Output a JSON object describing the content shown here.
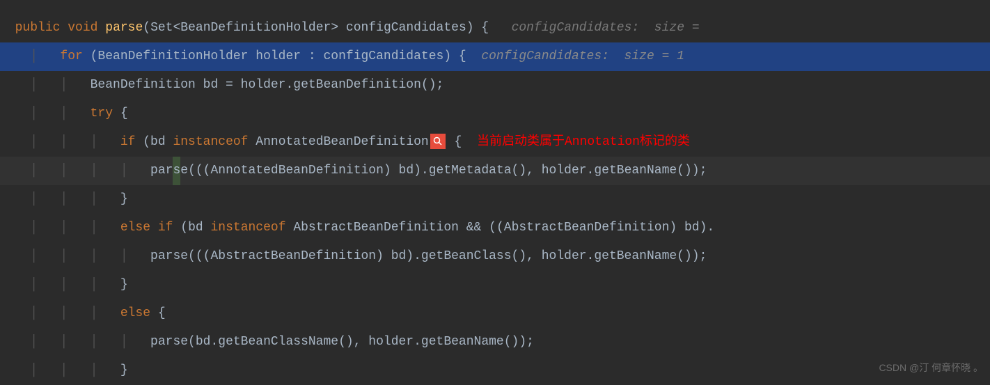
{
  "code": {
    "l1": {
      "kw1": "public",
      "kw2": "void",
      "method": "parse",
      "sig": "(Set<BeanDefinitionHolder> configCandidates) {",
      "hint": "configCandidates:  size ="
    },
    "l2": {
      "kw": "for",
      "body": " (BeanDefinitionHolder holder : configCandidates) {  ",
      "hint": "configCandidates:  size = 1"
    },
    "l3": {
      "text": "BeanDefinition bd = holder.getBeanDefinition();"
    },
    "l4": {
      "kw": "try",
      "text": " {"
    },
    "l5": {
      "kw": "if",
      "pre": " (bd ",
      "kw2": "instanceof",
      "mid": " AnnotatedBeanDefinition",
      "post": " {  ",
      "annot": "当前启动类属于Annotation标记的类"
    },
    "l6": {
      "pre": "par",
      "cursor": "s",
      "post": "e(((AnnotatedBeanDefinition) bd).getMetadata(), holder.getBeanName());"
    },
    "l7": {
      "text": "}"
    },
    "l8": {
      "kw1": "else",
      "kw2": "if",
      "pre": " (bd ",
      "kw3": "instanceof",
      "post": " AbstractBeanDefinition && ((AbstractBeanDefinition) bd)."
    },
    "l9": {
      "text": "parse(((AbstractBeanDefinition) bd).getBeanClass(), holder.getBeanName());"
    },
    "l10": {
      "text": "}"
    },
    "l11": {
      "kw": "else",
      "text": " {"
    },
    "l12": {
      "text": "parse(bd.getBeanClassName(), holder.getBeanName());"
    },
    "l13": {
      "text": "}"
    }
  },
  "indent": {
    "s2": "  ",
    "guide1": "    │   ",
    "guide2": "    │   │   ",
    "guide3": "    │   │   │   ",
    "guide4": "    │   │   │   │   "
  },
  "watermark": "CSDN @汀 何章怀晓 。"
}
